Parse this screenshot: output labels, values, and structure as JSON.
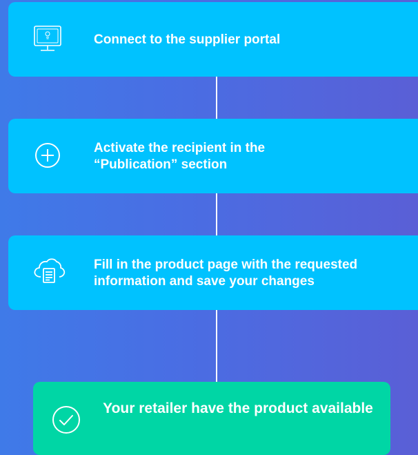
{
  "steps": [
    {
      "id": "step-1",
      "text": "Connect to the supplier portal",
      "icon": "monitor-icon"
    },
    {
      "id": "step-2",
      "text": "Activate the recipient in the “Publication” section",
      "icon": "plus-circle-icon"
    },
    {
      "id": "step-3",
      "text": "Fill in the product page with the requested information and save your changes",
      "icon": "cloud-document-icon"
    }
  ],
  "final": {
    "text": "Your retailer have the product available",
    "icon": "check-circle-icon"
  },
  "colors": {
    "background_start": "#3f7ae8",
    "background_end": "#5a5fd6",
    "step_box": "#00c2ff",
    "final_box": "#00d6a5",
    "text": "#ffffff",
    "connector": "#ffffff"
  }
}
